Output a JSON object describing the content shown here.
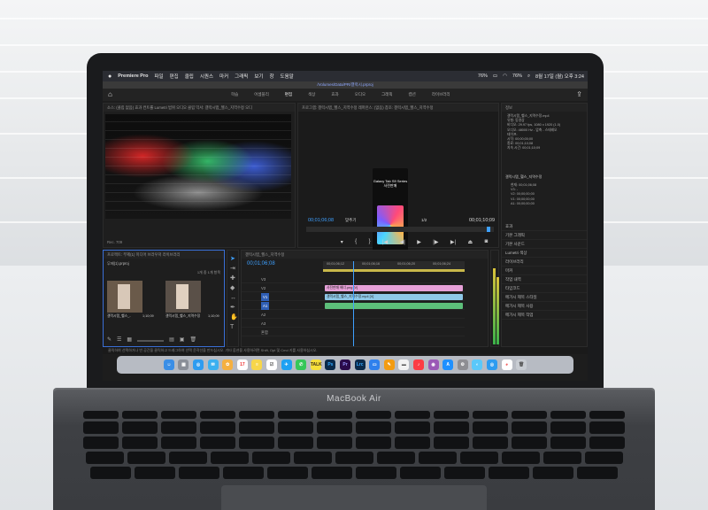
{
  "device": {
    "brand": "MacBook Air"
  },
  "menubar": {
    "app": "Premiere Pro",
    "items": [
      "파일",
      "편집",
      "클립",
      "시퀀스",
      "마커",
      "그래픽",
      "보기",
      "창",
      "도움말"
    ],
    "battery": "76%",
    "battery2": "76%",
    "clock": "8월 17일 (월) 오후 3:24"
  },
  "titlebar": {
    "path": "/Volumes/Data/PR/갤럭시.prproj"
  },
  "workspace": {
    "tabs": [
      "학습",
      "어셈블리",
      "편집",
      "색상",
      "효과",
      "오디오",
      "그래픽",
      "캡션",
      "라이브러리"
    ],
    "active_index": 2
  },
  "source_panel": {
    "tabs": "소스: (클립 없음)   효과 컨트롤   Lumetri 범위   오디오 클립 믹서: 갤럭시탭_헬스_지역수정   오디",
    "footer": "Rec. 709"
  },
  "program_panel": {
    "tabs": "프로그램: 갤럭시탭_헬스_지역수정   레퍼런스: (없음)   참조: 갤럭시탭_헬스_지역수정",
    "phone_title": "Galaxy Tab S9 Series 사전판매",
    "timecode_in": "00;01;06;08",
    "zoom": "맞추기",
    "ratio": "1/2",
    "timecode_out": "00;01;10;09"
  },
  "project_panel": {
    "tabs": "프로젝트: 무제(1)   미디어 브라우저   라이브러리",
    "file": "무제(1).prproj",
    "count": "1개 중 1개 항목",
    "items": [
      {
        "name": "갤럭시탭_헬스_..",
        "duration": "1;10;09"
      },
      {
        "name": "갤럭시탭_헬스_지역수정",
        "duration": "1;10;09"
      }
    ]
  },
  "timeline": {
    "tab": "갤럭시탭_헬스_지역수정",
    "timecode": "00;01;06;08",
    "ruler": [
      "00;01;06;12",
      "00;01;06;16",
      "00;01;06;20",
      "00;01;06;24"
    ],
    "tracks": [
      "V3",
      "V2",
      "V1",
      "A1",
      "A2",
      "A3",
      "혼합"
    ],
    "clips": [
      {
        "label": "사전판매 배너.png [V]",
        "color": "#e6a0d8"
      },
      {
        "label": "갤럭시탭_헬스_지역수정.mp4 [V]",
        "color": "#8ec8e8"
      },
      {
        "label": "",
        "color": "#5dbf7a"
      }
    ]
  },
  "info_panel": {
    "title": "정보",
    "lines": [
      "갤럭시탭_헬스_지역수정.mp4",
      "유형: 동영상",
      "비디오: 29.97 fps, 1080 x 1920 (1.0)",
      "오디오: 48000 Hz - 압축 - 스테레오",
      "테이프:",
      "시작: 00;00;00;00",
      "종료: 00;01;10;08",
      "지속 시간: 00;01;10;09"
    ],
    "sequence": "갤럭시탭_헬스_지역수정",
    "seq_lines": [
      "현재: 00;01;06;08",
      "V3: -",
      "V2: 00;00;00;00",
      "V1: 00;00;00;00",
      "A1: 00;00;00;00"
    ],
    "list": [
      "효과",
      "기본 그래픽",
      "기본 사운드",
      "Lumetri 색상",
      "라이브러리",
      "마커",
      "작업 내역",
      "타임코드",
      "메가시 제목 스타일",
      "메가시 제목 사용",
      "메가시 제목 작업"
    ]
  },
  "status_line": "클릭하여 선택하거나 빈 공간을 클릭하고 드래그하여 선택 윤곽선을 만드십시오. 기타 옵션을 사용하려면 Shift, Opt 및 Cmd 키를 사용하십시오.",
  "dock": {
    "apps": [
      "Finder",
      "Launchpad",
      "Safari",
      "Mail",
      "Photos",
      "Calendar",
      "Notes",
      "Reminders",
      "Twitter",
      "Messages",
      "KakaoTalk",
      "Photoshop",
      "Premiere Pro",
      "Lightroom Classic",
      "Keynote",
      "Pages",
      "Finder Folder",
      "Music",
      "Podcasts",
      "App Store",
      "System Preferences",
      "Preview",
      "Safari Browser",
      "Chrome",
      "Trash"
    ],
    "colors": {
      "ps": "#0a2a4a",
      "pr": "#2a0a4a",
      "lrc": "#0a2a4a"
    }
  }
}
